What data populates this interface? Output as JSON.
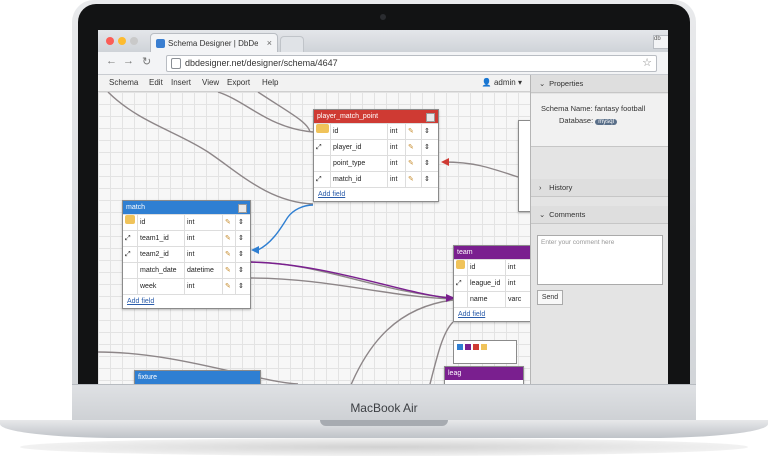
{
  "laptop": {
    "brand": "MacBook Air"
  },
  "browser": {
    "tab_title": "Schema Designer | DbDes",
    "tab_close": "×",
    "extension": "db",
    "url": "dbdesigner.net/designer/schema/4647",
    "back": "←",
    "forward": "→",
    "reload": "↻",
    "star": "☆"
  },
  "menubar": {
    "items": [
      "Schema",
      "Edit",
      "Insert",
      "View",
      "Export",
      "Help"
    ],
    "user": "admin",
    "user_caret": "▾"
  },
  "tables": {
    "player_match_point": {
      "name": "player_match_point",
      "color": "#cf3a33",
      "rows": [
        {
          "name": "id",
          "type": "int",
          "key": "pk"
        },
        {
          "name": "player_id",
          "type": "int",
          "key": "fk"
        },
        {
          "name": "point_type",
          "type": "int",
          "key": ""
        },
        {
          "name": "match_id",
          "type": "int",
          "key": "fk"
        }
      ],
      "add": "Add field"
    },
    "match": {
      "name": "match",
      "color": "#2f7fd2",
      "rows": [
        {
          "name": "id",
          "type": "int",
          "key": "pk"
        },
        {
          "name": "team1_id",
          "type": "int",
          "key": "fk"
        },
        {
          "name": "team2_id",
          "type": "int",
          "key": "fk"
        },
        {
          "name": "match_date",
          "type": "datetime",
          "key": ""
        },
        {
          "name": "week",
          "type": "int",
          "key": ""
        }
      ],
      "add": "Add field"
    },
    "team": {
      "name": "team",
      "color": "#7a1f8f",
      "rows": [
        {
          "name": "id",
          "type": "int",
          "key": "pk"
        },
        {
          "name": "league_id",
          "type": "int",
          "key": "fk"
        },
        {
          "name": "name",
          "type": "varc",
          "key": ""
        }
      ],
      "add": "Add field"
    },
    "fixture": {
      "name": "fixture",
      "color": "#2f7fd2"
    },
    "league": {
      "name": "leag",
      "color": "#7a1f8f"
    }
  },
  "panel": {
    "properties": "Properties",
    "schema_name_label": "Schema Name:",
    "schema_name": "fantasy football",
    "database_label": "Database:",
    "database": "mysql",
    "history": "History",
    "comments": "Comments",
    "comment_placeholder": "Enter your comment here",
    "send": "Send",
    "caret_open": "⌄",
    "caret_closed": "›"
  }
}
